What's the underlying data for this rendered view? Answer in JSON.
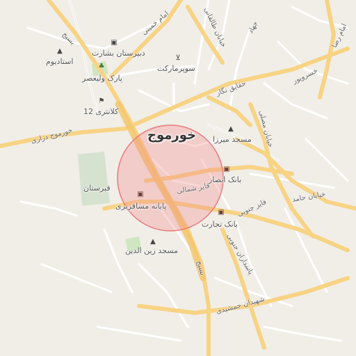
{
  "city": {
    "name": "خورموج"
  },
  "pois": [
    {
      "id": "stadium",
      "label": "استادیوم",
      "icon": "stadium-icon"
    },
    {
      "id": "school",
      "label": "دبیرستان بشارت",
      "icon": "school-icon"
    },
    {
      "id": "supermarket",
      "label": "سوپرمارکت",
      "icon": "cart-icon"
    },
    {
      "id": "park",
      "label": "پارک ولیعصر",
      "icon": "tree-icon"
    },
    {
      "id": "police",
      "label": "کلانتری 12",
      "icon": "police-icon"
    },
    {
      "id": "mosque_mirza",
      "label": "مسجد میرزا",
      "icon": "mosque-icon"
    },
    {
      "id": "bank_ansar",
      "label": "بانک انصار",
      "icon": "bank-icon"
    },
    {
      "id": "cemetery",
      "label": "قبرستان",
      "icon": "cemetery-icon"
    },
    {
      "id": "terminal",
      "label": "پایانه مسافربری",
      "icon": "bus-icon"
    },
    {
      "id": "bank_tejarat",
      "label": "بانک تجارت",
      "icon": "bank-icon"
    },
    {
      "id": "mosque_zeinodin",
      "label": "مسجد زین الدین",
      "icon": "mosque-icon"
    }
  ],
  "roads": [
    {
      "id": "khomeini",
      "label": "امام خمینی"
    },
    {
      "id": "taleghani",
      "label": "خیابان طالقانی"
    },
    {
      "id": "jahad",
      "label": "جهاد"
    },
    {
      "id": "imam_reza",
      "label": "امام رضا"
    },
    {
      "id": "basij_n",
      "label": "بسیج"
    },
    {
      "id": "haghayegh",
      "label": "حقایق نگار"
    },
    {
      "id": "khosravipour",
      "label": "خسروپور"
    },
    {
      "id": "mosalla",
      "label": "خیابان مصلی"
    },
    {
      "id": "khormoj_darai",
      "label": "خورموج دراری"
    },
    {
      "id": "faiz_shomali",
      "label": "فایز شمالی"
    },
    {
      "id": "faiz_jonubi",
      "label": "فایز جنوبی"
    },
    {
      "id": "hamed",
      "label": "خیابان حامد"
    },
    {
      "id": "pasdaran",
      "label": "پاسداران جنوبی"
    },
    {
      "id": "jamshidi",
      "label": "شهیدان جمشیدی"
    },
    {
      "id": "basij_s",
      "label": "بسیج"
    }
  ],
  "colors": {
    "highlight": "#f08c8c",
    "major_road": "#f9d57f",
    "minor_road": "#ffffff",
    "park": "#cfe6c0",
    "cemetery": "#d8e3d3"
  }
}
